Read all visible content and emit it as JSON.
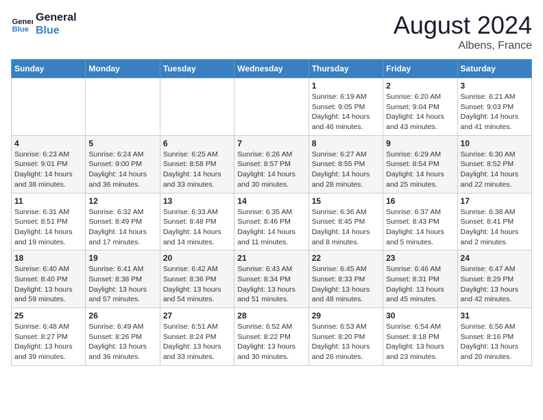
{
  "header": {
    "logo_line1": "General",
    "logo_line2": "Blue",
    "month_year": "August 2024",
    "location": "Albens, France"
  },
  "weekdays": [
    "Sunday",
    "Monday",
    "Tuesday",
    "Wednesday",
    "Thursday",
    "Friday",
    "Saturday"
  ],
  "weeks": [
    [
      {
        "day": "",
        "info": ""
      },
      {
        "day": "",
        "info": ""
      },
      {
        "day": "",
        "info": ""
      },
      {
        "day": "",
        "info": ""
      },
      {
        "day": "1",
        "info": "Sunrise: 6:19 AM\nSunset: 9:05 PM\nDaylight: 14 hours\nand 46 minutes."
      },
      {
        "day": "2",
        "info": "Sunrise: 6:20 AM\nSunset: 9:04 PM\nDaylight: 14 hours\nand 43 minutes."
      },
      {
        "day": "3",
        "info": "Sunrise: 6:21 AM\nSunset: 9:03 PM\nDaylight: 14 hours\nand 41 minutes."
      }
    ],
    [
      {
        "day": "4",
        "info": "Sunrise: 6:23 AM\nSunset: 9:01 PM\nDaylight: 14 hours\nand 38 minutes."
      },
      {
        "day": "5",
        "info": "Sunrise: 6:24 AM\nSunset: 9:00 PM\nDaylight: 14 hours\nand 36 minutes."
      },
      {
        "day": "6",
        "info": "Sunrise: 6:25 AM\nSunset: 8:58 PM\nDaylight: 14 hours\nand 33 minutes."
      },
      {
        "day": "7",
        "info": "Sunrise: 6:26 AM\nSunset: 8:57 PM\nDaylight: 14 hours\nand 30 minutes."
      },
      {
        "day": "8",
        "info": "Sunrise: 6:27 AM\nSunset: 8:55 PM\nDaylight: 14 hours\nand 28 minutes."
      },
      {
        "day": "9",
        "info": "Sunrise: 6:29 AM\nSunset: 8:54 PM\nDaylight: 14 hours\nand 25 minutes."
      },
      {
        "day": "10",
        "info": "Sunrise: 6:30 AM\nSunset: 8:52 PM\nDaylight: 14 hours\nand 22 minutes."
      }
    ],
    [
      {
        "day": "11",
        "info": "Sunrise: 6:31 AM\nSunset: 8:51 PM\nDaylight: 14 hours\nand 19 minutes."
      },
      {
        "day": "12",
        "info": "Sunrise: 6:32 AM\nSunset: 8:49 PM\nDaylight: 14 hours\nand 17 minutes."
      },
      {
        "day": "13",
        "info": "Sunrise: 6:33 AM\nSunset: 8:48 PM\nDaylight: 14 hours\nand 14 minutes."
      },
      {
        "day": "14",
        "info": "Sunrise: 6:35 AM\nSunset: 8:46 PM\nDaylight: 14 hours\nand 11 minutes."
      },
      {
        "day": "15",
        "info": "Sunrise: 6:36 AM\nSunset: 8:45 PM\nDaylight: 14 hours\nand 8 minutes."
      },
      {
        "day": "16",
        "info": "Sunrise: 6:37 AM\nSunset: 8:43 PM\nDaylight: 14 hours\nand 5 minutes."
      },
      {
        "day": "17",
        "info": "Sunrise: 6:38 AM\nSunset: 8:41 PM\nDaylight: 14 hours\nand 2 minutes."
      }
    ],
    [
      {
        "day": "18",
        "info": "Sunrise: 6:40 AM\nSunset: 8:40 PM\nDaylight: 13 hours\nand 59 minutes."
      },
      {
        "day": "19",
        "info": "Sunrise: 6:41 AM\nSunset: 8:38 PM\nDaylight: 13 hours\nand 57 minutes."
      },
      {
        "day": "20",
        "info": "Sunrise: 6:42 AM\nSunset: 8:36 PM\nDaylight: 13 hours\nand 54 minutes."
      },
      {
        "day": "21",
        "info": "Sunrise: 6:43 AM\nSunset: 8:34 PM\nDaylight: 13 hours\nand 51 minutes."
      },
      {
        "day": "22",
        "info": "Sunrise: 6:45 AM\nSunset: 8:33 PM\nDaylight: 13 hours\nand 48 minutes."
      },
      {
        "day": "23",
        "info": "Sunrise: 6:46 AM\nSunset: 8:31 PM\nDaylight: 13 hours\nand 45 minutes."
      },
      {
        "day": "24",
        "info": "Sunrise: 6:47 AM\nSunset: 8:29 PM\nDaylight: 13 hours\nand 42 minutes."
      }
    ],
    [
      {
        "day": "25",
        "info": "Sunrise: 6:48 AM\nSunset: 8:27 PM\nDaylight: 13 hours\nand 39 minutes."
      },
      {
        "day": "26",
        "info": "Sunrise: 6:49 AM\nSunset: 8:26 PM\nDaylight: 13 hours\nand 36 minutes."
      },
      {
        "day": "27",
        "info": "Sunrise: 6:51 AM\nSunset: 8:24 PM\nDaylight: 13 hours\nand 33 minutes."
      },
      {
        "day": "28",
        "info": "Sunrise: 6:52 AM\nSunset: 8:22 PM\nDaylight: 13 hours\nand 30 minutes."
      },
      {
        "day": "29",
        "info": "Sunrise: 6:53 AM\nSunset: 8:20 PM\nDaylight: 13 hours\nand 26 minutes."
      },
      {
        "day": "30",
        "info": "Sunrise: 6:54 AM\nSunset: 8:18 PM\nDaylight: 13 hours\nand 23 minutes."
      },
      {
        "day": "31",
        "info": "Sunrise: 6:56 AM\nSunset: 8:16 PM\nDaylight: 13 hours\nand 20 minutes."
      }
    ]
  ]
}
